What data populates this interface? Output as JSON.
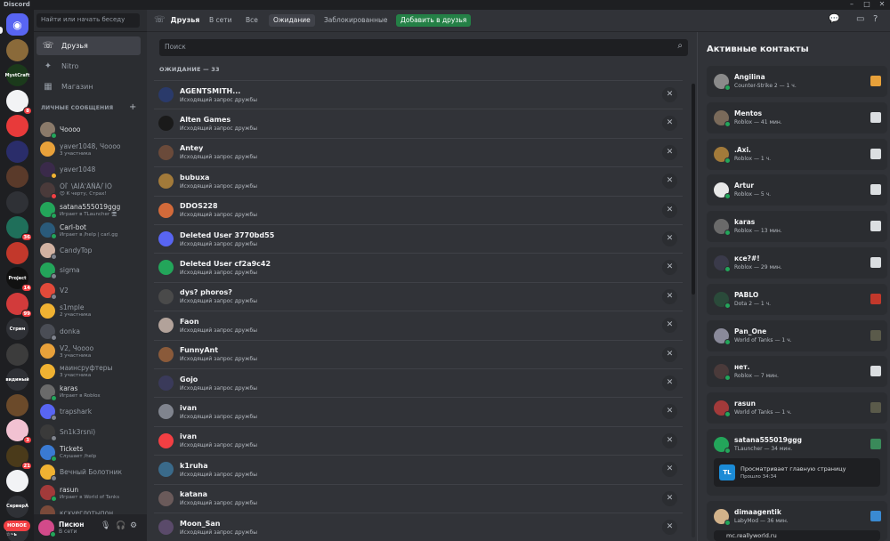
{
  "app": {
    "title": "Discord"
  },
  "colors": {
    "accent": "#5865f2",
    "online": "#23a55a",
    "idle": "#f0b232",
    "dnd": "#f23f43",
    "offline": "#80848e",
    "add_button": "#248046"
  },
  "guilds": [
    {
      "label": "",
      "color": "#5865f2",
      "icon": "discord-logo-icon",
      "badge": ""
    },
    {
      "label": "",
      "color": "#8a6a3a",
      "badge": ""
    },
    {
      "label": "MystCraft",
      "color": "#1b3a1b",
      "badge": ""
    },
    {
      "label": "",
      "color": "#f2f3f5",
      "badge": "8"
    },
    {
      "label": "",
      "color": "#e83a3a",
      "badge": ""
    },
    {
      "label": "",
      "color": "#2a2d6a",
      "badge": ""
    },
    {
      "label": "",
      "color": "#5a3a2a",
      "badge": ""
    },
    {
      "label": "",
      "color": "#2f3136",
      "badge": ""
    },
    {
      "label": "",
      "color": "#1f6f5a",
      "badge": "36"
    },
    {
      "label": "",
      "color": "#c2382b",
      "badge": ""
    },
    {
      "label": "Project",
      "color": "#111111",
      "badge": "14"
    },
    {
      "label": "",
      "color": "#d23b3b",
      "badge": "99"
    },
    {
      "label": "Стрим",
      "color": "#2f3136",
      "badge": ""
    },
    {
      "label": "",
      "color": "#3c3c3c",
      "badge": ""
    },
    {
      "label": "видимый",
      "color": "#2f3136",
      "badge": ""
    },
    {
      "label": "",
      "color": "#6b4a2a",
      "badge": ""
    },
    {
      "label": "",
      "color": "#f2c2d2",
      "badge": "3"
    },
    {
      "label": "",
      "color": "#4a3a1a",
      "badge": "21"
    },
    {
      "label": "",
      "color": "#f2f3f5",
      "badge": ""
    },
    {
      "label": "СерверА",
      "color": "#2f3136",
      "badge": ""
    },
    {
      "label": "рrзy ☆~ь",
      "color": "#2f3136",
      "badge": ""
    }
  ],
  "new_label": "НОВОЕ",
  "sidebar": {
    "search_placeholder": "Найти или начать беседу",
    "nav": [
      {
        "label": "Друзья",
        "icon": "friends-icon",
        "active": true
      },
      {
        "label": "Nitro",
        "icon": "nitro-icon",
        "active": false
      },
      {
        "label": "Магазин",
        "icon": "shop-icon",
        "active": false
      }
    ],
    "dm_header": "ЛИЧНЫЕ СООБЩЕНИЯ",
    "dms": [
      {
        "name": "Чoooo",
        "sub": "",
        "color": "#8a7a6a",
        "status": "online"
      },
      {
        "name": "yaver1048, Чoooo",
        "sub": "3 участника",
        "color": "#e8a13a",
        "status": ""
      },
      {
        "name": "yaver1048",
        "sub": "",
        "color": "#3a2a4a",
        "status": "idle"
      },
      {
        "name": "ÖÌ ̀ \\ÀÌÄ'ÄÑÄ/ ̀ÌÖ",
        "sub": "😈 К черту, Страх!",
        "color": "#4a3a3a",
        "status": "dnd"
      },
      {
        "name": "satana555019ggg",
        "sub": "Играет в TLauncher 🖥",
        "color": "#23a55a",
        "status": "online"
      },
      {
        "name": "Carl-bot",
        "sub": "Играет в /help | carl.gg",
        "color": "#2a5a7a",
        "status": "online"
      },
      {
        "name": "CandyTop",
        "sub": "",
        "color": "#d2b2a2",
        "status": "offline"
      },
      {
        "name": "sigma",
        "sub": "",
        "color": "#23a55a",
        "status": "offline"
      },
      {
        "name": "V2",
        "sub": "",
        "color": "#e24a3a",
        "status": "offline"
      },
      {
        "name": "s1mple",
        "sub": "2 участника",
        "color": "#f0b232",
        "status": ""
      },
      {
        "name": "donka",
        "sub": "",
        "color": "#4a4d55",
        "status": "offline"
      },
      {
        "name": "V2, Чoooo",
        "sub": "3 участника",
        "color": "#e8a13a",
        "status": ""
      },
      {
        "name": "маинсруфтеры",
        "sub": "3 участника",
        "color": "#f0b232",
        "status": ""
      },
      {
        "name": "karas",
        "sub": "Играет в Roblox",
        "color": "#6a6a6a",
        "status": "online"
      },
      {
        "name": "trapshark",
        "sub": "",
        "color": "#5865f2",
        "status": "offline"
      },
      {
        "name": "Sn1k3rsni)",
        "sub": "",
        "color": "#3a3a3a",
        "status": "offline"
      },
      {
        "name": "Tickets",
        "sub": "Слушает /help",
        "color": "#3a7ad2",
        "status": "online"
      },
      {
        "name": "Вечный Болотник",
        "sub": "",
        "color": "#f0b232",
        "status": "offline"
      },
      {
        "name": "rasun",
        "sub": "Играет в World of Tanks",
        "color": "#a23a3a",
        "status": "online"
      },
      {
        "name": "ксхуеглотыпон",
        "sub": "",
        "color": "#7a4a3a",
        "status": "offline"
      }
    ]
  },
  "user": {
    "name": "Писюн",
    "status": "В сети",
    "color": "#d24a8a"
  },
  "topbar": {
    "title": "Друзья",
    "tabs": [
      {
        "label": "В сети",
        "active": false
      },
      {
        "label": "Все",
        "active": false
      },
      {
        "label": "Ожидание",
        "active": true
      },
      {
        "label": "Заблокированные",
        "active": false
      }
    ],
    "add_friend": "Добавить в друзья"
  },
  "friends": {
    "search_placeholder": "Поиск",
    "count_label": "ОЖИДАНИЕ — 33",
    "rows": [
      {
        "name": "AGENTSMITH...",
        "sub": "Исходящий запрос дружбы",
        "color": "#2a3a6a"
      },
      {
        "name": "Alten Games",
        "sub": "Исходящий запрос дружбы",
        "color": "#1a1a1a"
      },
      {
        "name": "Antey",
        "sub": "Исходящий запрос дружбы",
        "color": "#6a4a3a"
      },
      {
        "name": "bubuxa",
        "sub": "Исходящий запрос дружбы",
        "color": "#a27a3a"
      },
      {
        "name": "DDOS228",
        "sub": "Исходящий запрос дружбы",
        "color": "#d26a3a"
      },
      {
        "name": "Deleted User 3770bd55",
        "sub": "Исходящий запрос дружбы",
        "color": "#5865f2"
      },
      {
        "name": "Deleted User cf2a9c42",
        "sub": "Исходящий запрос дружбы",
        "color": "#23a55a"
      },
      {
        "name": "dys? phoros?",
        "sub": "Исходящий запрос дружбы",
        "color": "#4a4a4a"
      },
      {
        "name": "Faon",
        "sub": "Исходящий запрос дружбы",
        "color": "#b2a29a"
      },
      {
        "name": "FunnyAnt",
        "sub": "Исходящий запрос дружбы",
        "color": "#8a5a3a"
      },
      {
        "name": "Gojo",
        "sub": "Исходящий запрос дружбы",
        "color": "#3a3a5a"
      },
      {
        "name": "ivan",
        "sub": "Исходящий запрос дружбы",
        "color": "#80848e"
      },
      {
        "name": "ivan",
        "sub": "Исходящий запрос дружбы",
        "color": "#f23f43"
      },
      {
        "name": "k1ruha",
        "sub": "Исходящий запрос дружбы",
        "color": "#3a6a8a"
      },
      {
        "name": "katana",
        "sub": "Исходящий запрос дружбы",
        "color": "#6a5a5a"
      },
      {
        "name": "Moon_San",
        "sub": "Исходящий запрос дружбы",
        "color": "#5a4a6a"
      }
    ]
  },
  "active": {
    "title": "Активные контакты",
    "cards": [
      {
        "name": "Angilina",
        "sub": "Counter-Strike 2 — 1 ч.",
        "color": "#8a8a8a",
        "game": "cs2-icon",
        "gcolor": "#e8a13a"
      },
      {
        "name": "Mentos",
        "sub": "Roblox — 41 мин.",
        "color": "#7a6a5a",
        "game": "roblox-icon",
        "gcolor": "#dbdee1"
      },
      {
        "name": ".Axi.",
        "sub": "Roblox — 1 ч.",
        "color": "#a27a3a",
        "game": "roblox-icon",
        "gcolor": "#dbdee1"
      },
      {
        "name": "Artur",
        "sub": "Roblox — 5 ч.",
        "color": "#e8e8e8",
        "game": "roblox-icon",
        "gcolor": "#dbdee1"
      },
      {
        "name": "karas",
        "sub": "Roblox — 13 мин.",
        "color": "#6a6a6a",
        "game": "roblox-icon",
        "gcolor": "#dbdee1"
      },
      {
        "name": "ксе?#!",
        "sub": "Roblox — 29 мин.",
        "color": "#3a3a4a",
        "game": "roblox-icon",
        "gcolor": "#dbdee1"
      },
      {
        "name": "PABLO",
        "sub": "Dota 2 — 1 ч.",
        "color": "#2a4a3a",
        "game": "dota2-icon",
        "gcolor": "#c2382b"
      },
      {
        "name": "Pan_One",
        "sub": "World of Tanks — 1 ч.",
        "color": "#8a8a9a",
        "game": "wot-icon",
        "gcolor": "#5a5a4a"
      },
      {
        "name": "нет.",
        "sub": "Roblox — 7 мин.",
        "color": "#4a3a3a",
        "game": "roblox-icon",
        "gcolor": "#dbdee1"
      },
      {
        "name": "rasun",
        "sub": "World of Tanks — 1 ч.",
        "color": "#a23a3a",
        "game": "wot-icon",
        "gcolor": "#5a5a4a"
      },
      {
        "name": "satana555019ggg",
        "sub": "TLauncher — 34 мин.",
        "color": "#23a55a",
        "game": "tlauncher-icon",
        "gcolor": "#3a8a5a",
        "detail_title": "Просматривает главную страницу",
        "detail_sub": "Прошло 34:34",
        "detail_icon": "TL"
      },
      {
        "name": "dimaagentik",
        "sub": "LabyMod — 36 мин.",
        "color": "#d2b28a",
        "game": "labymod-icon",
        "gcolor": "#3a8ad2",
        "detail_title": "mc.reallyworld.ru",
        "detail_sub": ""
      }
    ]
  }
}
